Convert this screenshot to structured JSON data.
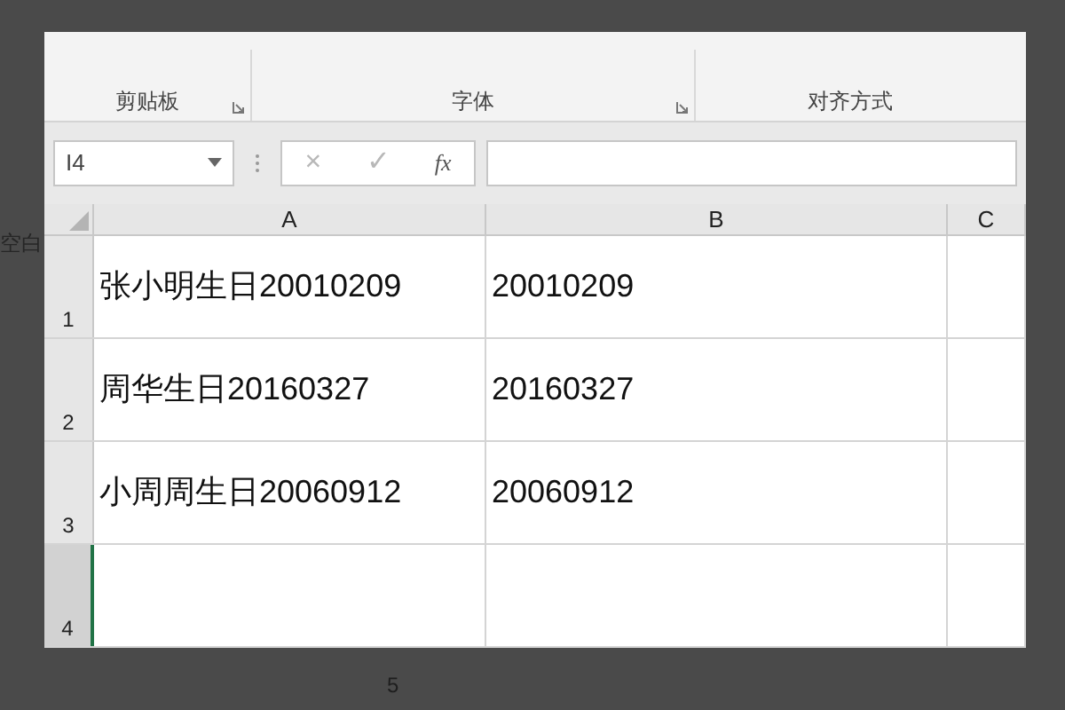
{
  "background_texts": [
    {
      "text": "空白"
    },
    {
      "text": "5"
    }
  ],
  "ribbon": {
    "groups": [
      {
        "label": "剪贴板",
        "launcher": true
      },
      {
        "label": "字体",
        "launcher": true
      },
      {
        "label": "对齐方式"
      }
    ]
  },
  "formula_bar": {
    "name_box": "I4",
    "buttons": [
      "×",
      "✓",
      "fx"
    ]
  },
  "columns": [
    {
      "label": "A"
    },
    {
      "label": "B"
    },
    {
      "label": "C"
    }
  ],
  "rows": [
    {
      "number": "1",
      "selected": false,
      "cells": [
        "张小明生日20010209",
        "20010209",
        ""
      ]
    },
    {
      "number": "2",
      "selected": false,
      "cells": [
        "周华生日20160327",
        "20160327",
        ""
      ]
    },
    {
      "number": "3",
      "selected": false,
      "cells": [
        "小周周生日20060912",
        "20060912",
        ""
      ]
    },
    {
      "number": "4",
      "selected": true,
      "cells": [
        "",
        "",
        ""
      ]
    }
  ]
}
